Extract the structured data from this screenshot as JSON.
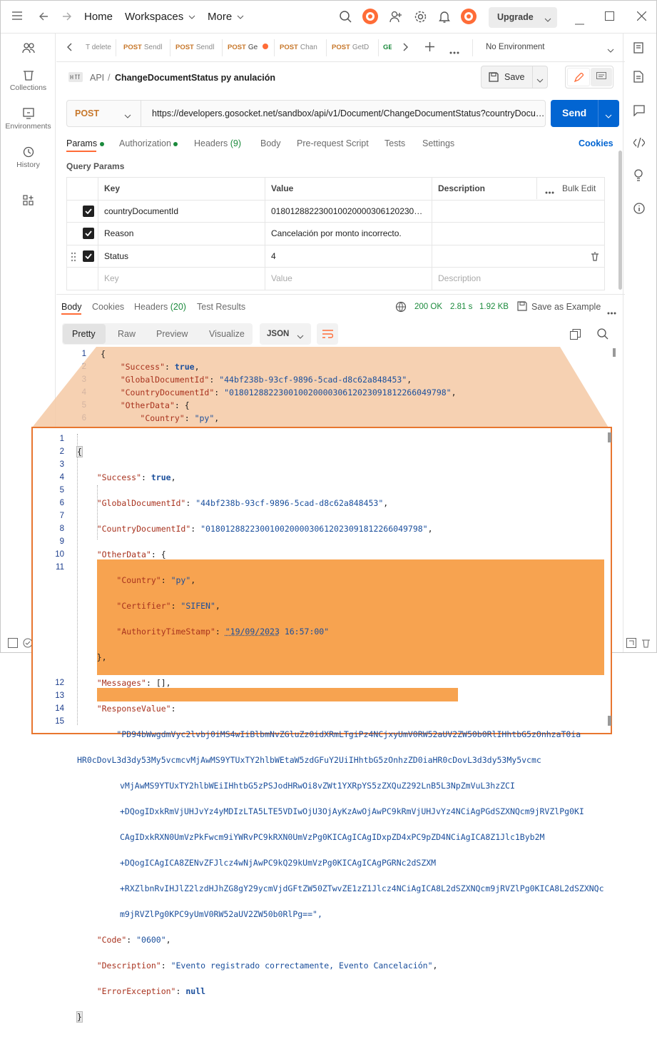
{
  "header": {
    "home": "Home",
    "workspaces": "Workspaces",
    "more": "More",
    "upgrade": "Upgrade"
  },
  "sidebar": {
    "items": [
      {
        "label": "Collections"
      },
      {
        "label": "Environments"
      },
      {
        "label": "History"
      }
    ]
  },
  "tabs": [
    {
      "method": "",
      "name": "T delete"
    },
    {
      "method": "POST",
      "name": "Sendl"
    },
    {
      "method": "POST",
      "name": "Sendl"
    },
    {
      "method": "POST",
      "name": "Ge"
    },
    {
      "method": "POST",
      "name": "Chan"
    },
    {
      "method": "POST",
      "name": "GetD"
    },
    {
      "method": "GE",
      "name": ""
    }
  ],
  "environment": "No Environment",
  "breadcrumb": {
    "root": "API",
    "sep": "/",
    "name": "ChangeDocumentStatus py anulación"
  },
  "save_label": "Save",
  "request": {
    "method": "POST",
    "url": "https://developers.gosocket.net/sandbox/api/v1/Document/ChangeDocumentStatus?countryDocu…",
    "send": "Send"
  },
  "request_tabs": {
    "params": "Params",
    "authorization": "Authorization",
    "headers": "Headers",
    "headers_count": "(9)",
    "body": "Body",
    "prerequest": "Pre-request Script",
    "tests": "Tests",
    "settings": "Settings",
    "cookies": "Cookies"
  },
  "query_params": {
    "title": "Query Params",
    "columns": {
      "key": "Key",
      "value": "Value",
      "description": "Description",
      "bulk_edit": "Bulk Edit"
    },
    "rows": [
      {
        "key": "countryDocumentId",
        "value": "018012882230010020000306120230…",
        "description": ""
      },
      {
        "key": "Reason",
        "value": "Cancelación por monto incorrecto.",
        "description": ""
      },
      {
        "key": "Status",
        "value": "4",
        "description": ""
      }
    ],
    "placeholder": {
      "key": "Key",
      "value": "Value",
      "description": "Description"
    }
  },
  "response": {
    "tabs": {
      "body": "Body",
      "cookies": "Cookies",
      "headers": "Headers",
      "headers_count": "(20)",
      "test_results": "Test Results"
    },
    "status": "200 OK",
    "time": "2.81 s",
    "size": "1.92 KB",
    "save_example": "Save as Example",
    "views": {
      "pretty": "Pretty",
      "raw": "Raw",
      "preview": "Preview",
      "visualize": "Visualize",
      "format": "JSON"
    }
  },
  "code_bg": {
    "lines": [
      "1",
      "2",
      "3",
      "4",
      "5",
      "6"
    ],
    "l2": {
      "k": "\"Success\"",
      "v": "true"
    },
    "l3": {
      "k": "\"GlobalDocumentId\"",
      "v": "\"44bf238b-93cf-9896-5cad-d8c62a848453\""
    },
    "l4": {
      "k": "\"CountryDocumentId\"",
      "v": "\"01801288223001002000030612023091812266049798\""
    },
    "l5": {
      "k": "\"OtherData\""
    },
    "l6": {
      "k": "\"Country\"",
      "v": "\"py\""
    }
  },
  "code_zoom": {
    "lines": [
      "1",
      "2",
      "3",
      "4",
      "5",
      "6",
      "7",
      "8",
      "9",
      "10",
      "11",
      "12",
      "13",
      "14",
      "15"
    ],
    "l2": {
      "k": "\"Success\"",
      "v": "true"
    },
    "l3": {
      "k": "\"GlobalDocumentId\"",
      "v": "\"44bf238b-93cf-9896-5cad-d8c62a848453\""
    },
    "l4": {
      "k": "\"CountryDocumentId\"",
      "v": "\"01801288223001002000030612023091812266049798\""
    },
    "l5": {
      "k": "\"OtherData\""
    },
    "l6": {
      "k": "\"Country\"",
      "v": "\"py\""
    },
    "l7": {
      "k": "\"Certifier\"",
      "v": "\"SIFEN\""
    },
    "l8": {
      "k": "\"AuthorityTimeStamp\"",
      "v1": "\"19/09/2023",
      "v2": " 16:57:00\""
    },
    "l10": {
      "k": "\"Messages\"",
      "v": "[]"
    },
    "l11": {
      "k": "\"ResponseValue\""
    },
    "rv": [
      "\"PD94bWwgdmVyc2lvbj0iMS4wIiBlbmNvZGluZz0idXRmLTgiPz4NCjxyUmV0RW52aUV2ZW50b0RlIHhtbG5zOnhzaT0ia",
      "HR0cDovL3d3dy53My5vcmcvMjAwMS9YTUxTY2hlbWEtaW5zdGFuY2UiIHhtbG5zOnhzZD0iaHR0cDovL3d3dy53My5vcmc",
      "vMjAwMS9YTUxTY2hlbWEiIHhtbG5zPSJodHRwOi8vZWt1YXRpYS5zZXQuZ292LnB5L3NpZmVuL3hzZCI",
      "+DQogIDxkRmVjUHJvYz4yMDIzLTA5LTE5VDIwOjU3OjAyKzAwOjAwPC9kRmVjUHJvYz4NCiAgPGdSZXNQcm9jRVZlPg0KI",
      "CAgIDxkRXN0UmVzPkFwcm9iYWRvPC9kRXN0UmVzPg0KICAgICAgIDxpZD4xPC9pZD4NCiAgICA8Z1Jlc1Byb2M",
      "+DQogICAgICA8ZENvZFJlcz4wNjAwPC9kQ29kUmVzPg0KICAgICAgPGRNc2dSZXM",
      "+RXZlbnRvIHJlZ2lzdHJhZG8gY29ycmVjdGFtZW50ZTwvZE1zZ1Jlcz4NCiAgICA8L2dSZXNQcm9jRVZlPg0KICA8L2dSZXNQc",
      "m9jRVZlPg0KPC9yUmV0RW52aUV2ZW50b0RlPg==\","
    ],
    "l12": {
      "k": "\"Code\"",
      "v": "\"0600\""
    },
    "l13": {
      "k": "\"Description\"",
      "v": "\"Evento registrado correctamente, Evento Cancelación\""
    },
    "l14": {
      "k": "\"ErrorException\"",
      "v": "null"
    }
  },
  "colors": {
    "accent": "#ff6c37",
    "send": "#0265d2",
    "highlight": "#f7a350",
    "zoom_border": "#e8762f",
    "zoom_overlay": "#f5c9a4",
    "token_key": "#a8321e",
    "token_value": "#1b4f9c"
  }
}
